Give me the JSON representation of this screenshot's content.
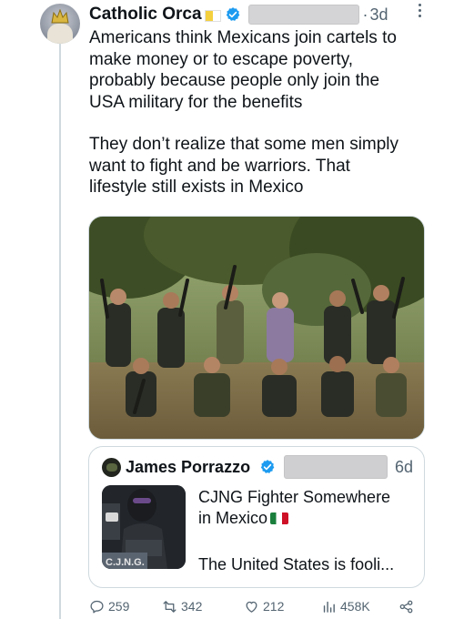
{
  "tweet": {
    "author_name": "Catholic Orca",
    "flag_icon": "vatican-flag-icon",
    "verified_icon": "verified-badge-icon",
    "separator": "·",
    "time": "3d",
    "paragraph_1": "Americans think Mexicans join cartels to\nmake money or to escape poverty,\nprobably because people only join the\nUSA military for the benefits",
    "paragraph_2": "They don’t realize that some men simply\nwant to fight and be warriors. That\nlifestyle still exists in Mexico"
  },
  "media": {
    "icon": "photo-group-of-armed-men-in-jungle"
  },
  "quote": {
    "author_name": "James Porrazzo",
    "verified_icon": "verified-badge-icon",
    "time": "6d",
    "text_line_1": "CJNG Fighter Somewhere",
    "text_line_2": "in Mexico",
    "flag_icon": "mexico-flag-icon",
    "text_line_3": "The United States is fooli...",
    "thumb_caption": "C.J.N.G."
  },
  "actions": {
    "replies": "259",
    "retweets": "342",
    "likes": "212",
    "views": "458K"
  },
  "colors": {
    "text": "#0f1419",
    "muted": "#536471",
    "verified": "#1d9bf0",
    "border": "#cfd9de"
  }
}
